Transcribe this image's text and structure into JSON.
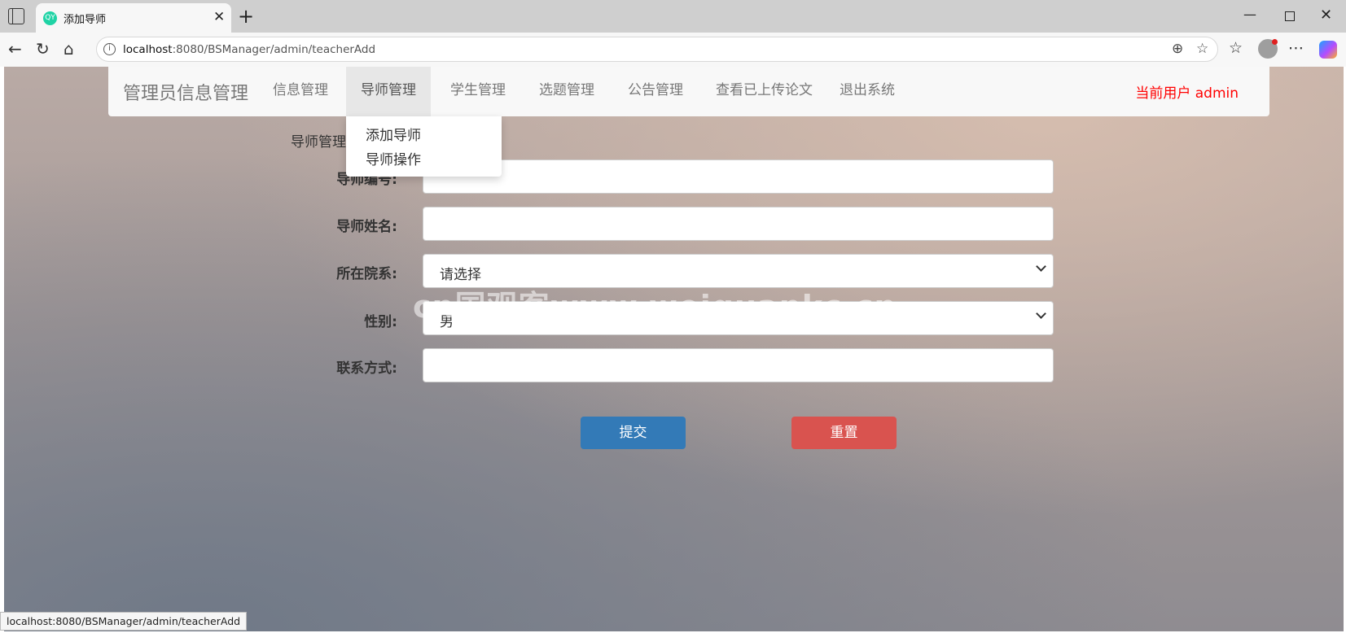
{
  "browser": {
    "tab_favicon_text": "QY",
    "tab_title": "添加导师",
    "url_host": "localhost",
    "url_rest": ":8080/BSManager/admin/teacherAdd",
    "status_url": "localhost:8080/BSManager/admin/teacherAdd"
  },
  "navbar": {
    "brand": "管理员信息管理",
    "items": [
      {
        "label": "信息管理"
      },
      {
        "label": "导师管理"
      },
      {
        "label": "学生管理"
      },
      {
        "label": "选题管理"
      },
      {
        "label": "公告管理"
      },
      {
        "label": "查看已上传论文"
      },
      {
        "label": "退出系统"
      }
    ],
    "current_user": "当前用户 admin"
  },
  "dropdown": {
    "items": [
      {
        "label": "添加导师"
      },
      {
        "label": "导师操作"
      }
    ]
  },
  "form": {
    "section_title": "导师管理",
    "teacher_id_label": "导师编号:",
    "teacher_id_value": "",
    "teacher_name_label": "导师姓名:",
    "teacher_name_value": "",
    "department_label": "所在院系:",
    "department_selected": "请选择",
    "gender_label": "性别:",
    "gender_selected": "男",
    "contact_label": "联系方式:",
    "contact_value": "",
    "submit_label": "提交",
    "reset_label": "重置"
  },
  "watermark": "cn国观客www.weiguankc.cn",
  "colors": {
    "accent_blue": "#337ab7",
    "danger_red": "#d9534f",
    "current_user_red": "#ff0000"
  },
  "icons": [
    "back-icon",
    "refresh-icon",
    "home-icon",
    "zoom-icon",
    "favorite-star-icon",
    "favorites-icon",
    "profile-icon",
    "more-icon",
    "copilot-icon",
    "chevron-down-icon"
  ]
}
